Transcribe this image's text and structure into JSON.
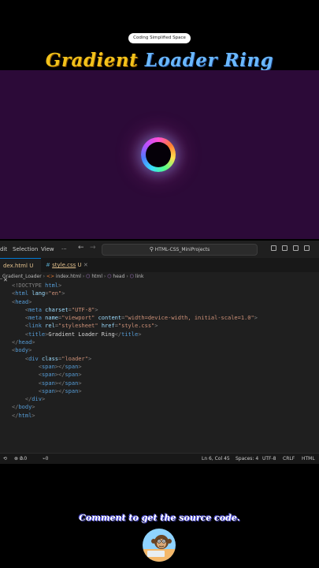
{
  "badge": "Coding Simplified Space",
  "title": {
    "part1": "Gradient",
    "part2": "Loader Ring"
  },
  "menu": {
    "edit": "dit",
    "selection": "Selection",
    "view": "View",
    "more": "···",
    "back": "←",
    "forward": "→",
    "search": "HTML-CSS_MiniProjects"
  },
  "tabs": [
    {
      "label": "dex.html",
      "status": "U",
      "close": "✕"
    },
    {
      "label": "style.css",
      "status": "U",
      "close": "✕"
    }
  ],
  "tab_icons": {
    "html": "<>",
    "css": "#"
  },
  "breadcrumbs": [
    "_Gradient_Loader",
    "index.html",
    "html",
    "head",
    "link"
  ],
  "code": [
    {
      "parts": [
        [
          "punc",
          "<!DOCTYPE "
        ],
        [
          "tag",
          "html"
        ],
        [
          "punc",
          ">"
        ]
      ]
    },
    {
      "parts": [
        [
          "punc",
          "<"
        ],
        [
          "tag",
          "html "
        ],
        [
          "attr",
          "lang"
        ],
        [
          "punc",
          "="
        ],
        [
          "str",
          "\"en\""
        ],
        [
          "punc",
          ">"
        ]
      ]
    },
    {
      "parts": [
        [
          "punc",
          "<"
        ],
        [
          "tag",
          "head"
        ],
        [
          "punc",
          ">"
        ]
      ]
    },
    {
      "parts": [
        [
          "txt",
          "    "
        ],
        [
          "punc",
          "<"
        ],
        [
          "tag",
          "meta "
        ],
        [
          "attr",
          "charset"
        ],
        [
          "punc",
          "="
        ],
        [
          "str",
          "\"UTF-8\""
        ],
        [
          "punc",
          ">"
        ]
      ]
    },
    {
      "parts": [
        [
          "txt",
          "    "
        ],
        [
          "punc",
          "<"
        ],
        [
          "tag",
          "meta "
        ],
        [
          "attr",
          "name"
        ],
        [
          "punc",
          "="
        ],
        [
          "str",
          "\"viewport\" "
        ],
        [
          "attr",
          "content"
        ],
        [
          "punc",
          "="
        ],
        [
          "str",
          "\"width=device-width, initial-scale=1.0\""
        ],
        [
          "punc",
          ">"
        ]
      ]
    },
    {
      "parts": [
        [
          "txt",
          "    "
        ],
        [
          "punc",
          "<"
        ],
        [
          "tag",
          "link "
        ],
        [
          "attr",
          "rel"
        ],
        [
          "punc",
          "="
        ],
        [
          "str",
          "\"stylesheet\" "
        ],
        [
          "attr",
          "href"
        ],
        [
          "punc",
          "="
        ],
        [
          "str",
          "\"style.css\""
        ],
        [
          "punc",
          ">"
        ]
      ]
    },
    {
      "parts": [
        [
          "txt",
          "    "
        ],
        [
          "punc",
          "<"
        ],
        [
          "tag",
          "title"
        ],
        [
          "punc",
          ">"
        ],
        [
          "txt",
          "Gradient Loader Ring"
        ],
        [
          "punc",
          "</"
        ],
        [
          "tag",
          "title"
        ],
        [
          "punc",
          ">"
        ]
      ]
    },
    {
      "parts": [
        [
          "punc",
          "</"
        ],
        [
          "tag",
          "head"
        ],
        [
          "punc",
          ">"
        ]
      ]
    },
    {
      "parts": [
        [
          "punc",
          "<"
        ],
        [
          "tag",
          "body"
        ],
        [
          "punc",
          ">"
        ]
      ]
    },
    {
      "parts": [
        [
          "txt",
          "    "
        ],
        [
          "punc",
          "<"
        ],
        [
          "tag",
          "div "
        ],
        [
          "attr",
          "class"
        ],
        [
          "punc",
          "="
        ],
        [
          "str",
          "\"loader\""
        ],
        [
          "punc",
          ">"
        ]
      ]
    },
    {
      "parts": [
        [
          "txt",
          "        "
        ],
        [
          "punc",
          "<"
        ],
        [
          "tag",
          "span"
        ],
        [
          "punc",
          "></"
        ],
        [
          "tag",
          "span"
        ],
        [
          "punc",
          ">"
        ]
      ]
    },
    {
      "parts": [
        [
          "txt",
          "        "
        ],
        [
          "punc",
          "<"
        ],
        [
          "tag",
          "span"
        ],
        [
          "punc",
          "></"
        ],
        [
          "tag",
          "span"
        ],
        [
          "punc",
          ">"
        ]
      ]
    },
    {
      "parts": [
        [
          "txt",
          "        "
        ],
        [
          "punc",
          "<"
        ],
        [
          "tag",
          "span"
        ],
        [
          "punc",
          "></"
        ],
        [
          "tag",
          "span"
        ],
        [
          "punc",
          ">"
        ]
      ]
    },
    {
      "parts": [
        [
          "txt",
          "        "
        ],
        [
          "punc",
          "<"
        ],
        [
          "tag",
          "span"
        ],
        [
          "punc",
          "></"
        ],
        [
          "tag",
          "span"
        ],
        [
          "punc",
          ">"
        ]
      ]
    },
    {
      "parts": [
        [
          "txt",
          "    "
        ],
        [
          "punc",
          "</"
        ],
        [
          "tag",
          "div"
        ],
        [
          "punc",
          ">"
        ]
      ]
    },
    {
      "parts": [
        [
          "punc",
          "</"
        ],
        [
          "tag",
          "body"
        ],
        [
          "punc",
          ">"
        ]
      ]
    },
    {
      "parts": [
        [
          "punc",
          "</"
        ],
        [
          "tag",
          "html"
        ],
        [
          "punc",
          ">"
        ]
      ]
    }
  ],
  "status": {
    "errors": "0",
    "warnings": "0",
    "ports": "0",
    "position": "Ln 6, Col 45",
    "spaces": "Spaces: 4",
    "encoding": "UTF-8",
    "eol": "CRLF",
    "language": "HTML"
  },
  "comment": "Comment to get the source code.",
  "colors": {
    "preview_bg": "#2c0a38",
    "editor_bg": "#1f1f1f",
    "tab_modified": "#e2c08d",
    "tab_css": "#519aba"
  }
}
